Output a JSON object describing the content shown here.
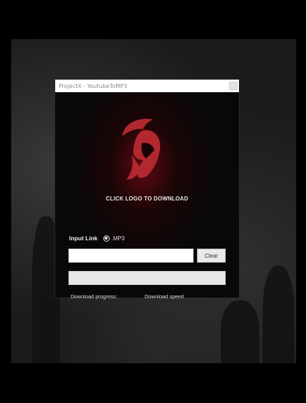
{
  "window": {
    "title": "ProjectX - YoutubeToMP3"
  },
  "logo": {
    "icon": "spartan-helmet-icon",
    "caption": "CLICK LOGO TO DOWNLOAD",
    "color": "#b3272f"
  },
  "form": {
    "input_label": "Input Link",
    "format_option": ".MP3",
    "format_selected": true,
    "link_value": "",
    "clear_label": "Clear"
  },
  "progress": {
    "value": 0
  },
  "status": {
    "progress_label": "Download progress:",
    "speed_label": "Download speed"
  }
}
